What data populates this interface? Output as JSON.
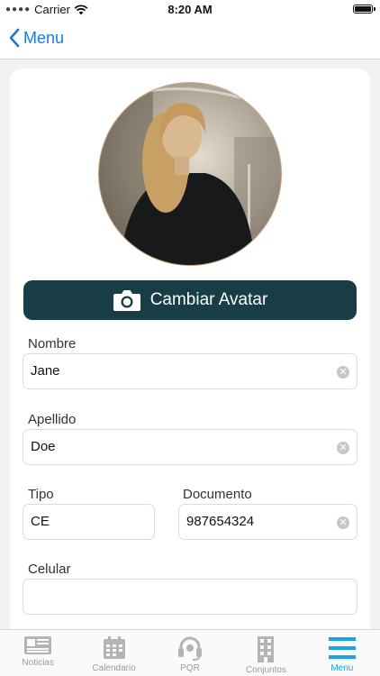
{
  "status_bar": {
    "carrier": "Carrier",
    "time": "8:20 AM"
  },
  "nav": {
    "back_label": "Menu"
  },
  "profile": {
    "change_avatar_label": "Cambiar Avatar"
  },
  "form": {
    "nombre": {
      "label": "Nombre",
      "value": "Jane"
    },
    "apellido": {
      "label": "Apellido",
      "value": "Doe"
    },
    "tipo": {
      "label": "Tipo",
      "value": "CE"
    },
    "documento": {
      "label": "Documento",
      "value": "987654324"
    },
    "celular": {
      "label": "Celular",
      "value": ""
    }
  },
  "tabs": [
    {
      "label": "Noticias",
      "icon": "news-icon"
    },
    {
      "label": "Calendario",
      "icon": "calendar-icon"
    },
    {
      "label": "PQR",
      "icon": "headset-icon"
    },
    {
      "label": "Conjuntos",
      "icon": "building-icon"
    },
    {
      "label": "Menu",
      "icon": "menu-icon"
    }
  ],
  "colors": {
    "accent": "#1a7bd8",
    "button_bg": "#183d47",
    "tab_active": "#1aa3e8",
    "tab_inactive": "#9a9a9a"
  }
}
